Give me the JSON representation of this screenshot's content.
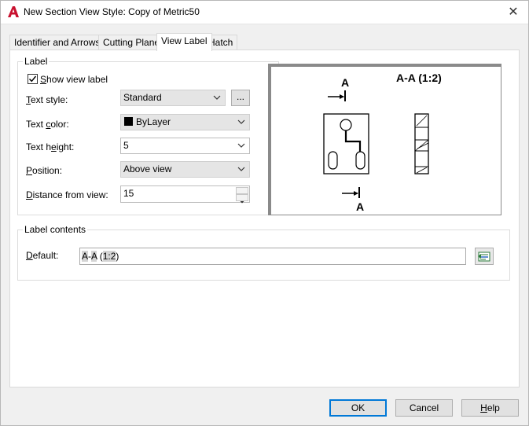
{
  "window": {
    "title": "New Section View Style: Copy of Metric50",
    "close_glyph": "✕",
    "app_icon": "autocad-a-icon",
    "brand_color": "#c8102e"
  },
  "tabs": [
    {
      "label": "Identifier and Arrows",
      "active": false
    },
    {
      "label": "Cutting Plane",
      "active": false
    },
    {
      "label": "View Label",
      "active": true
    },
    {
      "label": "Hatch",
      "active": false
    }
  ],
  "label_group": {
    "title": "Label",
    "show_view_label": {
      "label": "Show view label",
      "checked": true
    },
    "text_style": {
      "label": "Text style:",
      "value": "Standard",
      "browse_label": "..."
    },
    "text_color": {
      "label": "Text color:",
      "value": "ByLayer",
      "swatch_color": "#000000"
    },
    "text_height": {
      "label": "Text height:",
      "value": "5"
    },
    "position": {
      "label": "Position:",
      "value": "Above view"
    },
    "distance_from_view": {
      "label": "Distance from view:",
      "value": "15"
    }
  },
  "preview": {
    "top_identifier": "A",
    "bottom_identifier": "A",
    "view_label": "A-A (1:2)"
  },
  "label_contents": {
    "title": "Label contents",
    "default_label": "Default:",
    "value_parts": [
      "A",
      "-",
      "A",
      " (",
      "1:2",
      ")"
    ],
    "edit_button_icon": "field-edit-icon",
    "accent_color": "#2a7a3a"
  },
  "buttons": {
    "ok": "OK",
    "cancel": "Cancel",
    "help": "Help"
  }
}
